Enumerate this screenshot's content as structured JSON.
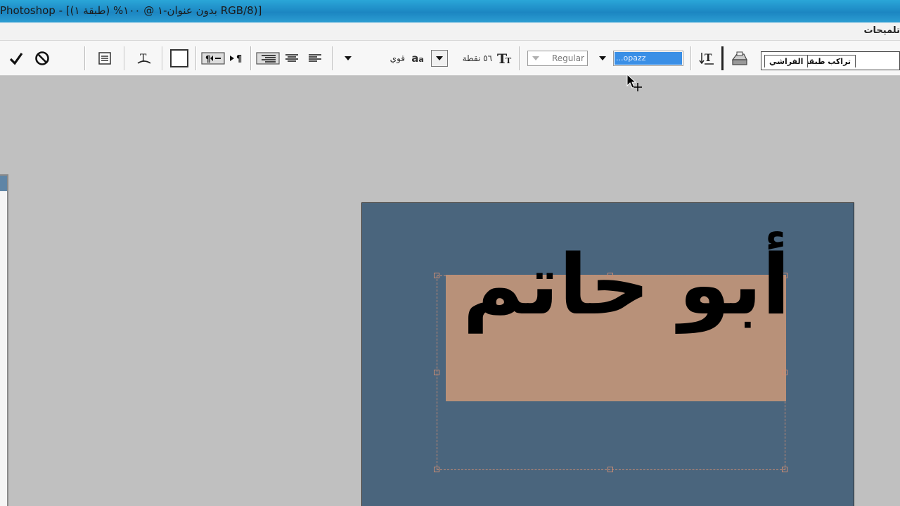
{
  "window": {
    "title": "Photoshop - [بدون عنوان-١ @ ١٠٠% (طبقة ١) RGB/8)]"
  },
  "menubar": {
    "right_label": "تلميحات"
  },
  "options": {
    "font_family_value": "...opazz",
    "font_style_value": "Regular",
    "font_size_value": "٥٦ نقطة",
    "antialias_value": "قوي",
    "icons": [
      "commit-check-icon",
      "cancel-icon",
      "palettes-icon",
      "warp-text-icon",
      "color-swatch-icon",
      "rtl-direction-icon",
      "ltr-direction-icon",
      "align-right-icon",
      "align-center-icon",
      "align-left-icon",
      "text-size-icon",
      "text-orientation-icon",
      "tool-preset-icon"
    ],
    "text_color": "#ffffff"
  },
  "palette_well": {
    "tabs": [
      "تراكب طبقة",
      "الفراشي"
    ]
  },
  "canvas": {
    "background_color": "#4a657d",
    "rect_color": "#b89179",
    "text": "أبو حاتم",
    "text_color": "#000000"
  }
}
